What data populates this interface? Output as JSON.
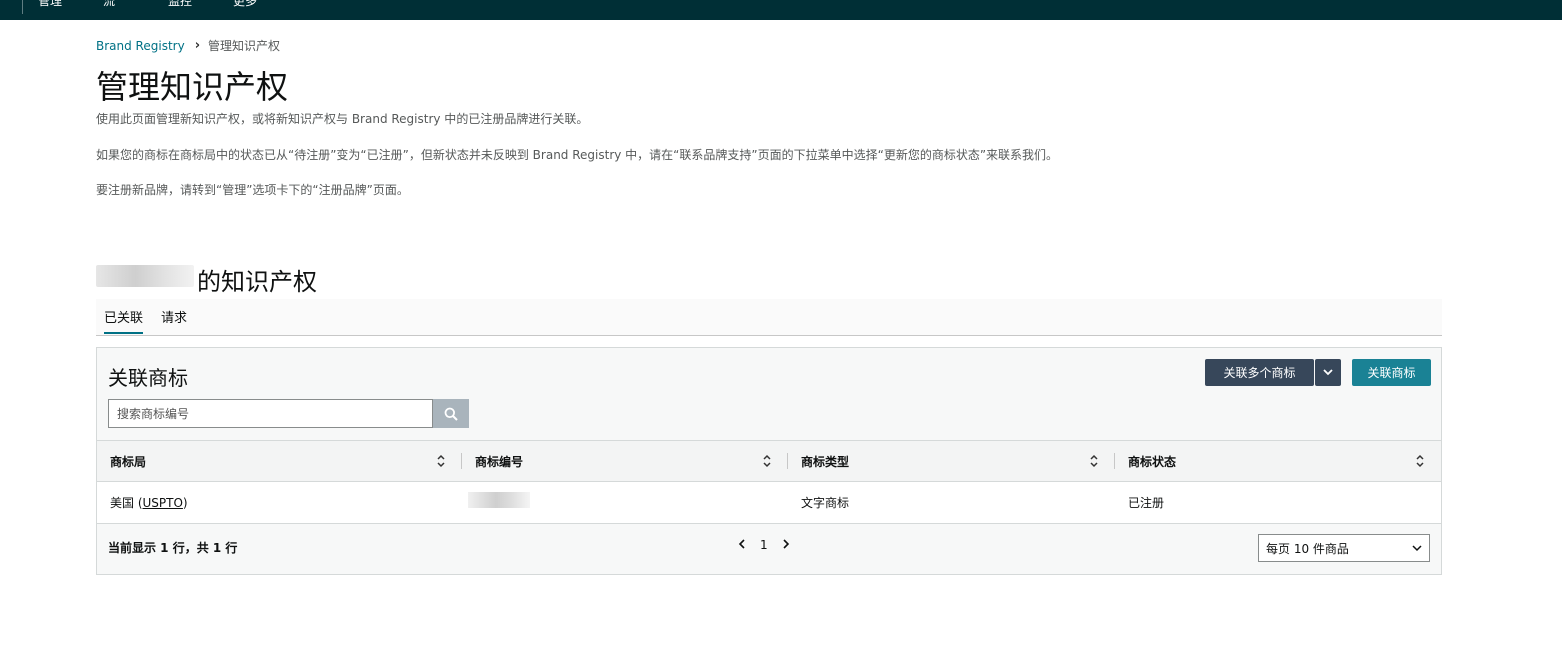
{
  "topbar": {
    "nav_items": [
      "管理",
      "流",
      "监控",
      "更多"
    ]
  },
  "breadcrumb": {
    "root": "Brand Registry",
    "current": "管理知识产权"
  },
  "page": {
    "title": "管理知识产权",
    "paragraphs": [
      "使用此页面管理新知识产权，或将新知识产权与 Brand Registry 中的已注册品牌进行关联。",
      "如果您的商标在商标局中的状态已从“待注册”变为“已注册”，但新状态并未反映到 Brand Registry 中，请在“联系品牌支持”页面的下拉菜单中选择“更新您的商标状态”来联系我们。",
      "要注册新品牌，请转到“管理”选项卡下的“注册品牌”页面。"
    ]
  },
  "section": {
    "title": "的知识产权"
  },
  "tabs": [
    {
      "label": "已关联",
      "active": true
    },
    {
      "label": "请求",
      "active": false
    }
  ],
  "card": {
    "title": "关联商标",
    "link_multiple_label": "关联多个商标",
    "link_label": "关联商标",
    "search": {
      "placeholder": "搜索商标编号",
      "value": ""
    },
    "columns": [
      "商标局",
      "商标编号",
      "商标类型",
      "商标状态"
    ],
    "rows": [
      {
        "office_prefix": "美国 (",
        "office_abbr": "USPTO",
        "office_suffix": ")",
        "number": "",
        "type": "文字商标",
        "status": "已注册"
      }
    ],
    "pager": {
      "info": "当前显示 1 行，共 1 行",
      "page": "1",
      "per_page": "每页 10 件商品"
    }
  },
  "colors": {
    "topbar": "#002f36",
    "link": "#007185",
    "dark_button": "#37475a",
    "teal_button": "#1a8295",
    "search_button": "#a9b4bc"
  }
}
